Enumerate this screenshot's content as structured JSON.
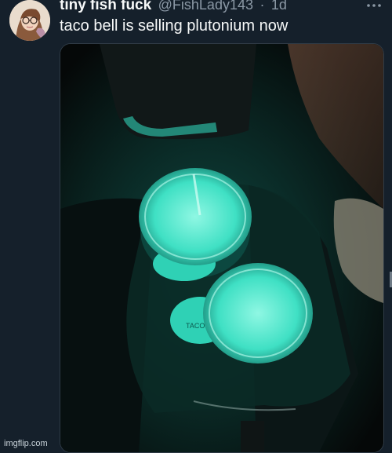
{
  "tweet": {
    "display_name": "tiny fish fuck",
    "handle": "@FishLady143",
    "separator": "·",
    "time": "1d",
    "text": "taco bell is selling plutonium now",
    "more_icon": "more-horizontal-icon"
  },
  "media": {
    "cup_lid_text": "TACO BELL"
  },
  "watermark": "imgflip.com",
  "colors": {
    "background": "#15202b",
    "glow": "#3fe0c4",
    "secondary_text": "#8b98a5"
  }
}
